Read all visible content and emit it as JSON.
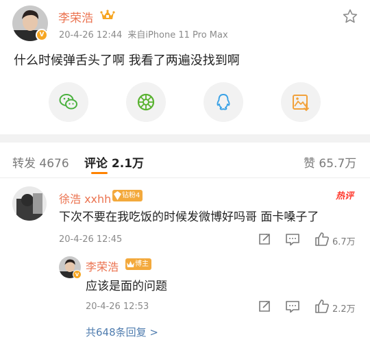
{
  "post": {
    "author": "李荣浩",
    "date": "20-4-26 12:44",
    "source": "来自iPhone 11 Pro Max",
    "text": "什么时候弹舌头了啊 我看了两遍没找到啊",
    "verified_badge": "V"
  },
  "share_buttons": [
    {
      "name": "wechat",
      "icon": "wechat-icon",
      "color": "#4ab13e"
    },
    {
      "name": "moments",
      "icon": "moments-icon",
      "color": "#58b22f"
    },
    {
      "name": "qq",
      "icon": "qq-icon",
      "color": "#3aa2e6"
    },
    {
      "name": "save-image",
      "icon": "picture-icon",
      "color": "#f2a13a"
    }
  ],
  "tabs": {
    "repost": "转发 4676",
    "comment": "评论 2.1万",
    "like": "赞 65.7万"
  },
  "comment": {
    "author": "徐浩 xxhh",
    "badge": "钻粉4",
    "hot_label": "热评",
    "text": "下次不要在我吃饭的时候发微博好吗哥 面卡嗓子了",
    "time": "20-4-26 12:45",
    "likes": "6.7万"
  },
  "reply": {
    "author": "李荣浩",
    "badge": "博主",
    "text": "应该是面的问题",
    "time": "20-4-26 12:53",
    "likes": "2.2万"
  },
  "more_replies": "共648条回复 >",
  "colors": {
    "accent_orange": "#ff8200",
    "name_orange": "#eb7350",
    "link_blue": "#507daf",
    "hot_red": "#ff3b2f"
  }
}
